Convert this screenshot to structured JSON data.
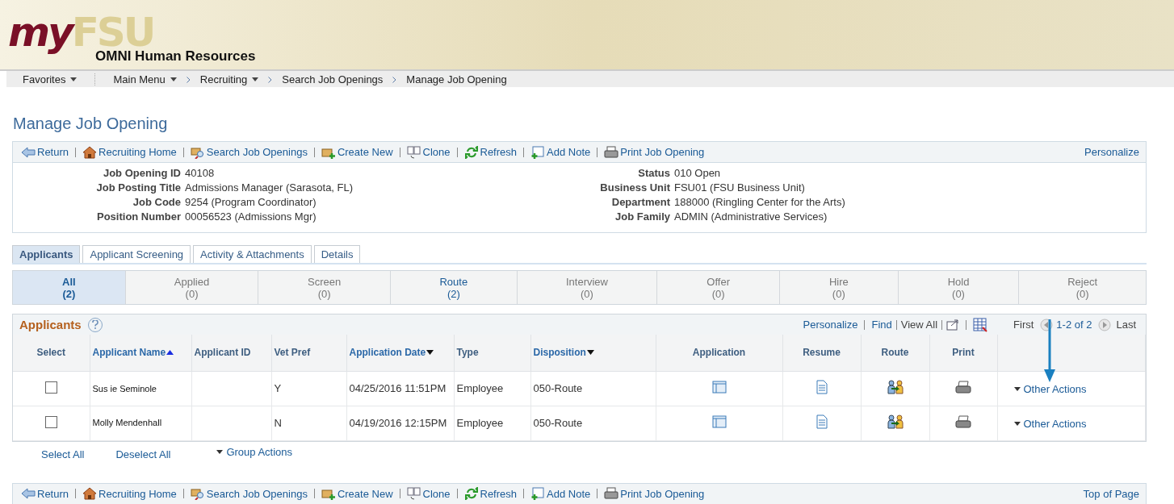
{
  "header": {
    "logo_a": "my",
    "logo_b": "FSU",
    "subtitle": "OMNI Human Resources"
  },
  "nav": [
    {
      "label": "Favorites",
      "menu": true
    },
    {
      "label": "Main Menu",
      "menu": true
    },
    {
      "label": "Recruiting",
      "menu": true
    },
    {
      "label": "Search Job Openings",
      "menu": false
    },
    {
      "label": "Manage Job Opening",
      "menu": false
    }
  ],
  "page_title": "Manage Job Opening",
  "toolbar": {
    "items": [
      {
        "kind": "return",
        "label": "Return"
      },
      {
        "kind": "home",
        "label": "Recruiting Home"
      },
      {
        "kind": "search",
        "label": "Search Job Openings"
      },
      {
        "kind": "create",
        "label": "Create New"
      },
      {
        "kind": "clone",
        "label": "Clone"
      },
      {
        "kind": "refresh",
        "label": "Refresh"
      },
      {
        "kind": "note",
        "label": "Add Note"
      },
      {
        "kind": "print",
        "label": "Print Job Opening"
      }
    ],
    "right": "Personalize"
  },
  "details_left": [
    {
      "label": "Job Opening ID",
      "value": "40108"
    },
    {
      "label": "Job Posting Title",
      "value": "Admissions Manager (Sarasota, FL)"
    },
    {
      "label": "Job Code",
      "value": "9254 (Program Coordinator)"
    },
    {
      "label": "Position Number",
      "value": "00056523 (Admissions Mgr)"
    }
  ],
  "details_right": [
    {
      "label": "Status",
      "value": "010 Open"
    },
    {
      "label": "Business Unit",
      "value": "FSU01 (FSU Business Unit)"
    },
    {
      "label": "Department",
      "value": "188000 (Ringling Center for the Arts)"
    },
    {
      "label": "Job Family",
      "value": "ADMIN (Administrative Services)"
    }
  ],
  "tabs": [
    {
      "label": "Applicants",
      "selected": true
    },
    {
      "label": "Applicant Screening",
      "selected": false
    },
    {
      "label": "Activity & Attachments",
      "selected": false
    },
    {
      "label": "Details",
      "selected": false
    }
  ],
  "status_filters": [
    {
      "label": "All",
      "count": "(2)",
      "selected": true,
      "enabled": true
    },
    {
      "label": "Applied",
      "count": "(0)",
      "selected": false,
      "enabled": false
    },
    {
      "label": "Screen",
      "count": "(0)",
      "selected": false,
      "enabled": false
    },
    {
      "label": "Route",
      "count": "(2)",
      "selected": false,
      "enabled": true
    },
    {
      "label": "Interview",
      "count": "(0)",
      "selected": false,
      "enabled": false
    },
    {
      "label": "Offer",
      "count": "(0)",
      "selected": false,
      "enabled": false
    },
    {
      "label": "Hire",
      "count": "(0)",
      "selected": false,
      "enabled": false
    },
    {
      "label": "Hold",
      "count": "(0)",
      "selected": false,
      "enabled": false
    },
    {
      "label": "Reject",
      "count": "(0)",
      "selected": false,
      "enabled": false
    }
  ],
  "grid": {
    "title": "Applicants",
    "personalize": "Personalize",
    "find": "Find",
    "view_all": "View All",
    "first": "First",
    "range": "1-2 of 2",
    "last": "Last",
    "columns": [
      {
        "label": "Select",
        "sorted_ascending": false,
        "sorted_descending": false
      },
      {
        "label": "Applicant Name",
        "sorted_ascending": true,
        "sorted_descending": false
      },
      {
        "label": "Applicant ID",
        "sorted_ascending": false,
        "sorted_descending": false
      },
      {
        "label": "Vet Pref",
        "sorted_ascending": false,
        "sorted_descending": false
      },
      {
        "label": "Application Date",
        "sorted_ascending": false,
        "sorted_descending": true
      },
      {
        "label": "Type",
        "sorted_ascending": false,
        "sorted_descending": false
      },
      {
        "label": "Disposition",
        "sorted_ascending": false,
        "sorted_descending": true
      },
      {
        "label": "Application",
        "sorted_ascending": false,
        "sorted_descending": false
      },
      {
        "label": "Resume",
        "sorted_ascending": false,
        "sorted_descending": false
      },
      {
        "label": "Route",
        "sorted_ascending": false,
        "sorted_descending": false
      },
      {
        "label": "Print",
        "sorted_ascending": false,
        "sorted_descending": false
      }
    ],
    "rows": [
      {
        "checked": false,
        "name": "Sus ie Seminole",
        "vet_pref": "Y",
        "application_date": "04/25/2016 11:51PM",
        "type": "Employee",
        "disposition": "050-Route",
        "other_actions": "Other Actions"
      },
      {
        "checked": false,
        "name": "Molly Mendenhall",
        "vet_pref": "N",
        "application_date": "04/19/2016 12:15PM",
        "type": "Employee",
        "disposition": "050-Route",
        "other_actions": "Other Actions"
      }
    ]
  },
  "grid_actions": {
    "select_all": "Select All",
    "deselect_all": "Deselect All",
    "group_actions": "Group Actions"
  },
  "bottom_toolbar": {
    "items": [
      {
        "kind": "return",
        "label": "Return"
      },
      {
        "kind": "home",
        "label": "Recruiting Home"
      },
      {
        "kind": "search",
        "label": "Search Job Openings"
      },
      {
        "kind": "create",
        "label": "Create New"
      },
      {
        "kind": "clone",
        "label": "Clone"
      },
      {
        "kind": "refresh",
        "label": "Refresh"
      },
      {
        "kind": "note",
        "label": "Add Note"
      },
      {
        "kind": "print",
        "label": "Print Job Opening"
      }
    ],
    "right": "Top of Page"
  }
}
